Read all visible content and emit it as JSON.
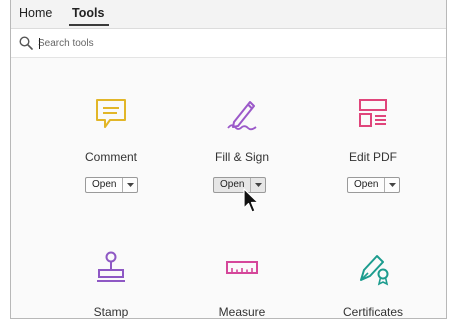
{
  "tabs": {
    "home": "Home",
    "tools": "Tools"
  },
  "search": {
    "placeholder": "Search tools"
  },
  "tools": [
    {
      "label": "Comment",
      "icon": "comment-icon",
      "color": "#e2b628",
      "open_label": "Open"
    },
    {
      "label": "Fill & Sign",
      "icon": "pen-sign-icon",
      "color": "#9b59c9",
      "open_label": "Open"
    },
    {
      "label": "Edit PDF",
      "icon": "edit-pdf-icon",
      "color": "#e0457b",
      "open_label": "Open"
    },
    {
      "label": "Stamp",
      "icon": "stamp-icon",
      "color": "#8e58c4"
    },
    {
      "label": "Measure",
      "icon": "ruler-icon",
      "color": "#d5479a"
    },
    {
      "label": "Certificates",
      "icon": "certificate-pen-icon",
      "color": "#1c9c8e"
    }
  ]
}
